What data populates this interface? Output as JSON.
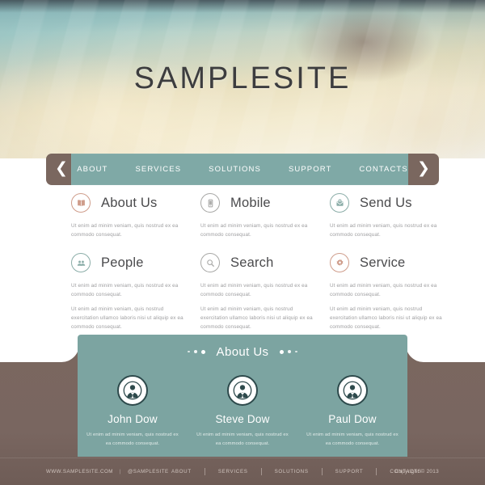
{
  "header": {
    "site_title": "SAMPLESITE"
  },
  "nav": {
    "prev_arrow": "❮",
    "next_arrow": "❯",
    "items": [
      {
        "label": "ABOUT"
      },
      {
        "label": "SERVICES"
      },
      {
        "label": "SOLUTIONS"
      },
      {
        "label": "SUPPORT"
      },
      {
        "label": "CONTACTS"
      }
    ]
  },
  "features": {
    "short_text": "Ut enim ad minim veniam, quis nostrud ex ea commodo consequat.",
    "long_text": "Ut enim ad minim veniam, quis nostrud exercitation ullamco laboris nisi ut aliquip ex ea commodo consequat.",
    "row1": [
      {
        "title": "About Us",
        "icon": "open-book-icon",
        "color": "#cf9d8b"
      },
      {
        "title": "Mobile",
        "icon": "mobile-phone-icon",
        "color": "#a8a8a6"
      },
      {
        "title": "Send Us",
        "icon": "envelope-icon",
        "color": "#8bada8"
      }
    ],
    "row2": [
      {
        "title": "People",
        "icon": "people-icon",
        "color": "#8bada8"
      },
      {
        "title": "Search",
        "icon": "magnifier-icon",
        "color": "#a8a8a6"
      },
      {
        "title": "Service",
        "icon": "gear-icon",
        "color": "#cf9d8b"
      }
    ]
  },
  "about_panel": {
    "title": "About Us",
    "members": [
      {
        "name": "John Dow",
        "bio": "Ut enim ad minim veniam, quis nostrud ex ea commodo consequat."
      },
      {
        "name": "Steve Dow",
        "bio": "Ut enim ad minim veniam, quis nostrud ex ea commodo consequat."
      },
      {
        "name": "Paul Dow",
        "bio": "Ut enim ad minim veniam, quis nostrud ex ea commodo consequat."
      }
    ]
  },
  "footer": {
    "website": "WWW.SAMPLESITE.COM",
    "divider": "|",
    "social": "@SAMPLESITE",
    "links": [
      {
        "label": "ABOUT"
      },
      {
        "label": "SERVICES"
      },
      {
        "label": "SOLUTIONS"
      },
      {
        "label": "SUPPORT"
      },
      {
        "label": "CONTACTS"
      }
    ],
    "copyright": "Copyright © 2013"
  },
  "colors": {
    "teal": "#7ca4a1",
    "nav_teal": "#7fa9a6",
    "brown": "#7a675f",
    "salmon": "#cf9d8b",
    "grey": "#a8a8a6",
    "panel_avatar_ring": "#2e4a4c"
  }
}
